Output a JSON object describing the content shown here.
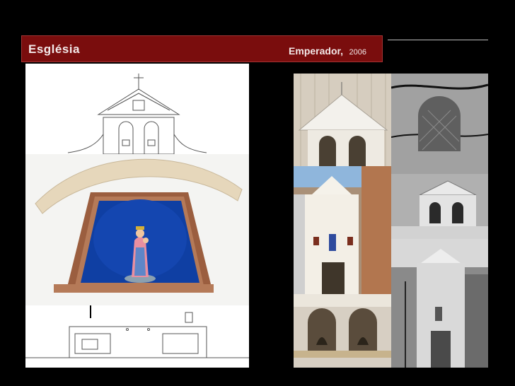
{
  "header": {
    "title": "Església",
    "place": "Emperador,",
    "year": "2006"
  },
  "colors": {
    "header_bg": "#7a0d0d",
    "page_bg": "#000000"
  }
}
